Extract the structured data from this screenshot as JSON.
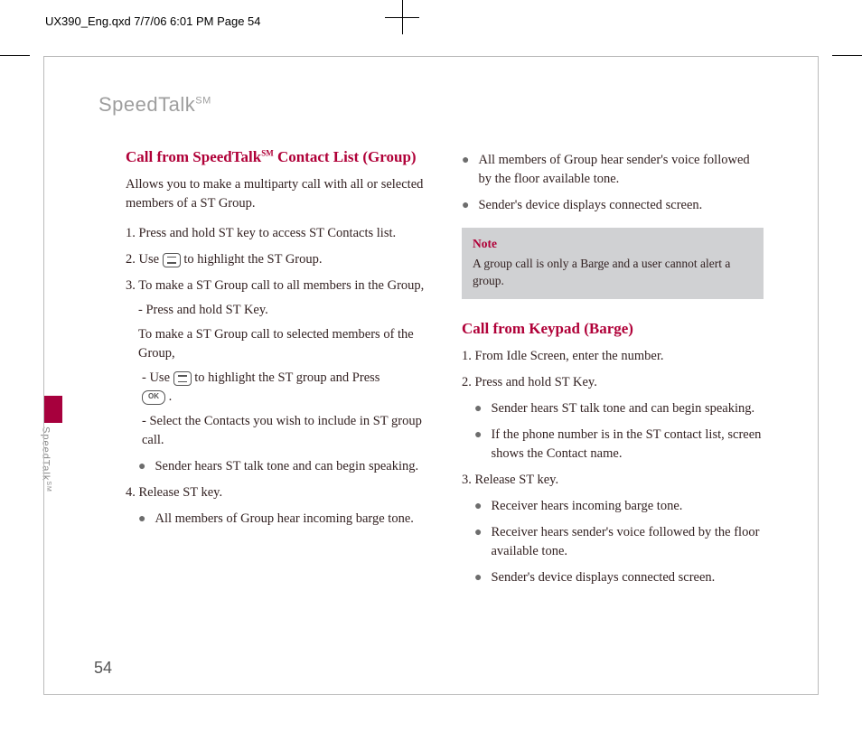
{
  "printmark": "UX390_Eng.qxd  7/7/06  6:01 PM  Page 54",
  "header": {
    "title": "SpeedTalk",
    "sup": "SM"
  },
  "side": {
    "label": "SpeedTalk",
    "sup": "SM"
  },
  "page_number": "54",
  "icons": {
    "ok_label": "OK"
  },
  "left": {
    "heading_pre": "Call from SpeedTalk",
    "heading_sup": "SM",
    "heading_post": " Contact List (Group)",
    "intro": "Allows you to make a multiparty call with all or selected members of a ST Group.",
    "s1": "1. Press and hold ST key to access ST Contacts list.",
    "s2a": "2. Use ",
    "s2b": " to highlight the ST Group.",
    "s3": "3. To make a ST Group call to all members in the Group,",
    "s3_sub1": "- Press and hold ST Key.",
    "s3_text": "To make a ST Group call to selected members of the Group,",
    "s3_sub2a": "- Use ",
    "s3_sub2b": " to highlight the ST group and Press ",
    "s3_sub2c": " .",
    "s3_sub3": "- Select the Contacts you wish to include in ST group call.",
    "s3_bullet": "Sender hears ST talk tone and can begin speaking.",
    "s4": "4. Release ST key.",
    "s4_bullet": "All members of Group hear incoming barge tone."
  },
  "right": {
    "top_b1": "All members of Group hear sender's voice followed by the floor available tone.",
    "top_b2": "Sender's device displays connected screen.",
    "note_title": "Note",
    "note_body": "A group call is only a Barge and a user cannot alert a group.",
    "heading2": "Call from Keypad (Barge)",
    "k1": "1. From Idle Screen, enter the number.",
    "k2": "2. Press and hold ST Key.",
    "k2_b1": "Sender hears ST talk tone and can begin speaking.",
    "k2_b2": "If the phone number is in the ST contact list, screen shows the Contact name.",
    "k3": "3. Release ST key.",
    "k3_b1": "Receiver hears incoming barge tone.",
    "k3_b2": "Receiver hears sender's voice followed by the floor available tone.",
    "k3_b3": "Sender's device displays connected screen."
  }
}
